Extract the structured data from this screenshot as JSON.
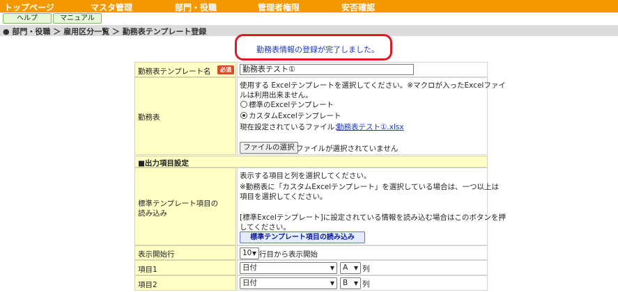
{
  "nav": {
    "items": [
      "トップページ",
      "マスタ管理",
      "部門・役職",
      "管理者権限",
      "安否確認"
    ]
  },
  "subnav": {
    "help": "ヘルプ",
    "manual": "マニュアル"
  },
  "breadcrumb": "● 部門・役職 ＞ 雇用区分一覧 ＞ 勤務表テンプレート登録",
  "message": "勤務表情報の登録が完了しました。",
  "form": {
    "template_name_label": "勤務表テンプレート名",
    "required_badge": "必須",
    "template_name_value": "勤務表テスト①",
    "sheet_label": "勤務表",
    "sheet_desc1": "使用する Excelテンプレートを選択してください。※マクロが入ったExcelファイ",
    "sheet_desc2": "ルは利用出来ません。",
    "radio_standard": "標準のExcelテンプレート",
    "radio_custom": "カスタムExcelテンプレート",
    "current_file_label": "現在設定されているファイル：",
    "current_file": "勤務表テスト①.xlsx",
    "choose_file": "ファイルの選択",
    "no_file": "ファイルが選択されていません",
    "section_output": "■出力項目設定",
    "load_label1": "標準テンプレート項目の",
    "load_label2": "読み込み",
    "load_desc1": "表示する項目と列を選択してください。",
    "load_desc2": "※勤務表に「カスタムExcelテンプレート」を選択している場合は、一つ以上は",
    "load_desc3": "項目を選択してください。",
    "load_desc4": "[標準Excelテンプレート]に設定されている情報を読み込む場合はこのボタンを押",
    "load_desc5": "してください。",
    "load_button": "標準テンプレート項目の読み込み",
    "start_row_label": "表示開始行",
    "start_row_value": "10",
    "start_row_suffix": "行目から表示開始",
    "item1_label": "項目1",
    "item1_value": "日付",
    "item1_col": "A",
    "item2_label": "項目2",
    "item2_value": "日付",
    "item2_col": "B",
    "col_suffix": "列"
  }
}
